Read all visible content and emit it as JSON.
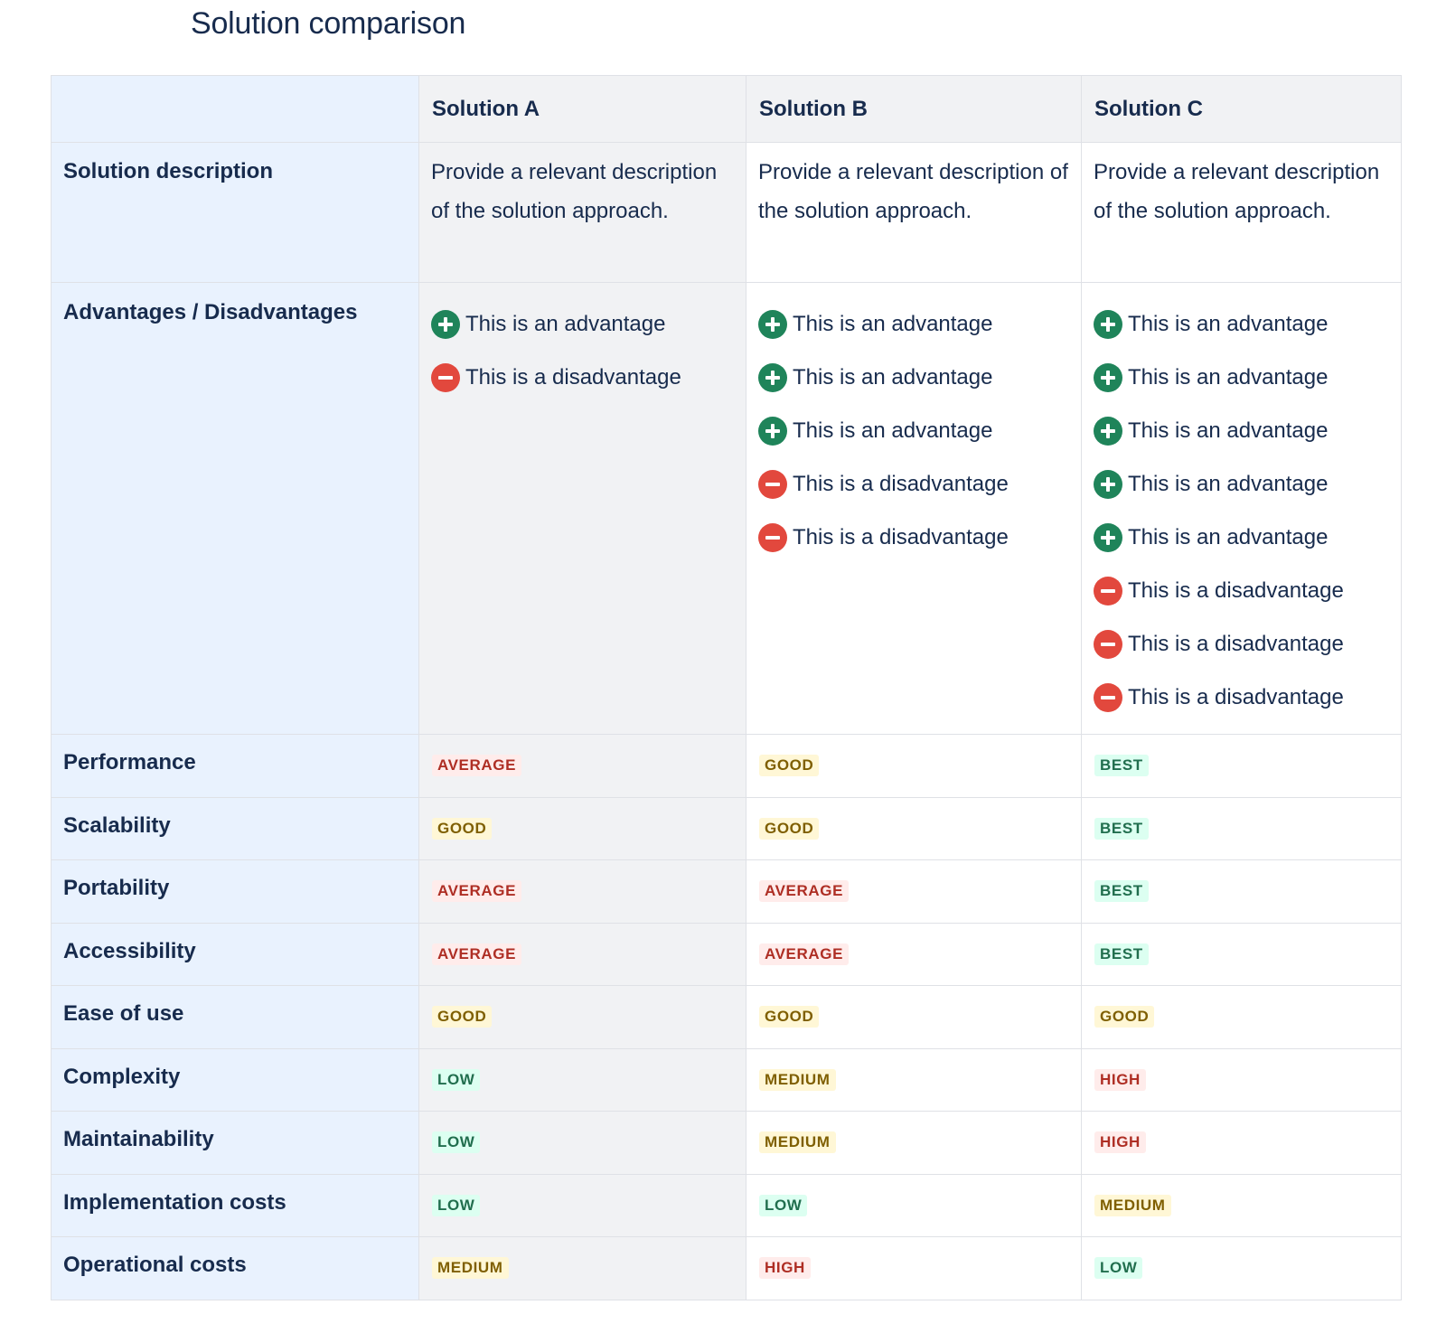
{
  "title": "Solution comparison",
  "columns": [
    "Solution A",
    "Solution B",
    "Solution C"
  ],
  "description_row": {
    "label": "Solution description",
    "values": [
      "Provide a relevant description of the solution approach.",
      "Provide a relevant description of the solution approach.",
      "Provide a relevant description of the solution approach."
    ]
  },
  "adv_row": {
    "label": "Advantages / Disadvantages",
    "cells": [
      [
        {
          "kind": "plus",
          "text": "This is an advantage"
        },
        {
          "kind": "minus",
          "text": "This is a disadvantage"
        }
      ],
      [
        {
          "kind": "plus",
          "text": "This is an advantage"
        },
        {
          "kind": "plus",
          "text": "This is an advantage"
        },
        {
          "kind": "plus",
          "text": "This is an advantage"
        },
        {
          "kind": "minus",
          "text": "This is a disadvantage"
        },
        {
          "kind": "minus",
          "text": "This is a disadvantage"
        }
      ],
      [
        {
          "kind": "plus",
          "text": "This is an advantage"
        },
        {
          "kind": "plus",
          "text": "This is an advantage"
        },
        {
          "kind": "plus",
          "text": "This is an advantage"
        },
        {
          "kind": "plus",
          "text": "This is an advantage"
        },
        {
          "kind": "plus",
          "text": "This is an advantage"
        },
        {
          "kind": "minus",
          "text": "This is a disadvantage"
        },
        {
          "kind": "minus",
          "text": "This is a disadvantage"
        },
        {
          "kind": "minus",
          "text": "This is a disadvantage"
        }
      ]
    ]
  },
  "icons": {
    "plus": "add-circle-icon",
    "minus": "remove-circle-icon",
    "plus_color": "#1f845a",
    "minus_color": "#e2483d"
  },
  "lozenge_colors": {
    "red": {
      "bg": "#ffeceb",
      "fg": "#ae2e24"
    },
    "yellow": {
      "bg": "#fff7d6",
      "fg": "#7f5f01"
    },
    "green": {
      "bg": "#dcfff1",
      "fg": "#216e4e"
    }
  },
  "metrics": [
    {
      "label": "Performance",
      "values": [
        {
          "text": "AVERAGE",
          "tone": "red"
        },
        {
          "text": "GOOD",
          "tone": "yellow"
        },
        {
          "text": "BEST",
          "tone": "green"
        }
      ]
    },
    {
      "label": "Scalability",
      "values": [
        {
          "text": "GOOD",
          "tone": "yellow"
        },
        {
          "text": "GOOD",
          "tone": "yellow"
        },
        {
          "text": "BEST",
          "tone": "green"
        }
      ]
    },
    {
      "label": "Portability",
      "values": [
        {
          "text": "AVERAGE",
          "tone": "red"
        },
        {
          "text": "AVERAGE",
          "tone": "red"
        },
        {
          "text": "BEST",
          "tone": "green"
        }
      ]
    },
    {
      "label": "Accessibility",
      "values": [
        {
          "text": "AVERAGE",
          "tone": "red"
        },
        {
          "text": "AVERAGE",
          "tone": "red"
        },
        {
          "text": "BEST",
          "tone": "green"
        }
      ]
    },
    {
      "label": "Ease of use",
      "values": [
        {
          "text": "GOOD",
          "tone": "yellow"
        },
        {
          "text": "GOOD",
          "tone": "yellow"
        },
        {
          "text": "GOOD",
          "tone": "yellow"
        }
      ]
    },
    {
      "label": "Complexity",
      "values": [
        {
          "text": "LOW",
          "tone": "green"
        },
        {
          "text": "MEDIUM",
          "tone": "yellow"
        },
        {
          "text": "HIGH",
          "tone": "red"
        }
      ]
    },
    {
      "label": "Maintainability",
      "values": [
        {
          "text": "LOW",
          "tone": "green"
        },
        {
          "text": "MEDIUM",
          "tone": "yellow"
        },
        {
          "text": "HIGH",
          "tone": "red"
        }
      ]
    },
    {
      "label": "Implementation costs",
      "values": [
        {
          "text": "LOW",
          "tone": "green"
        },
        {
          "text": "LOW",
          "tone": "green"
        },
        {
          "text": "MEDIUM",
          "tone": "yellow"
        }
      ]
    },
    {
      "label": "Operational costs",
      "values": [
        {
          "text": "MEDIUM",
          "tone": "yellow"
        },
        {
          "text": "HIGH",
          "tone": "red"
        },
        {
          "text": "LOW",
          "tone": "green"
        }
      ]
    }
  ]
}
